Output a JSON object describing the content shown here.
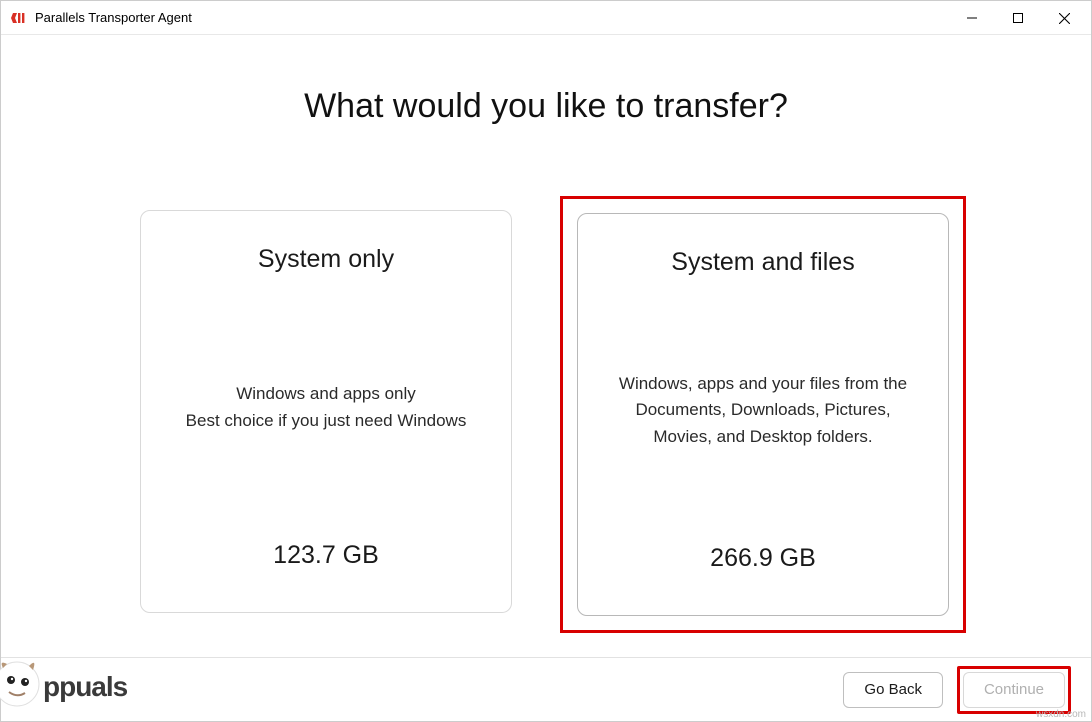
{
  "titlebar": {
    "title": "Parallels Transporter Agent"
  },
  "main": {
    "heading": "What would you like to transfer?",
    "options": [
      {
        "title": "System only",
        "desc_line1": "Windows and apps only",
        "desc_line2": "Best choice if you just need Windows",
        "size": "123.7 GB",
        "highlighted": false
      },
      {
        "title": "System and files",
        "desc_line1": "Windows, apps and your files from the Documents, Downloads, Pictures, Movies, and Desktop folders.",
        "desc_line2": "",
        "size": "266.9 GB",
        "highlighted": true
      }
    ]
  },
  "footer": {
    "back_label": "Go Back",
    "continue_label": "Continue"
  },
  "watermark": "wsxdn.com",
  "overlay_brand": "Appuals"
}
